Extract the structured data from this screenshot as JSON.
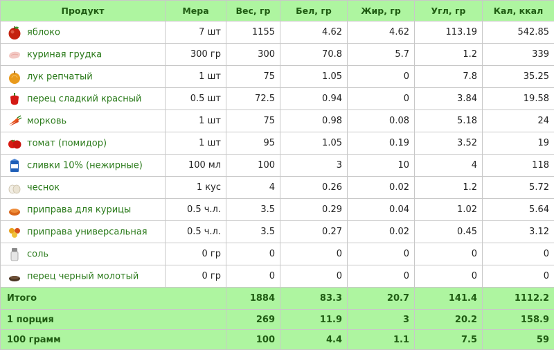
{
  "header": {
    "product": "Продукт",
    "mera": "Мера",
    "ves": "Вес, гр",
    "bel": "Бел, гр",
    "zhir": "Жир, гр",
    "ugl": "Угл, гр",
    "kal": "Кал, ккал"
  },
  "items": [
    {
      "name": "яблоко",
      "icon": "apple-icon",
      "mera": "7 шт",
      "ves": "1155",
      "bel": "4.62",
      "zhir": "4.62",
      "ugl": "113.19",
      "kal": "542.85"
    },
    {
      "name": "куриная грудка",
      "icon": "chicken-breast-icon",
      "mera": "300 гр",
      "ves": "300",
      "bel": "70.8",
      "zhir": "5.7",
      "ugl": "1.2",
      "kal": "339"
    },
    {
      "name": "лук репчатый",
      "icon": "onion-icon",
      "mera": "1 шт",
      "ves": "75",
      "bel": "1.05",
      "zhir": "0",
      "ugl": "7.8",
      "kal": "35.25"
    },
    {
      "name": "перец сладкий красный",
      "icon": "red-pepper-icon",
      "mera": "0.5 шт",
      "ves": "72.5",
      "bel": "0.94",
      "zhir": "0",
      "ugl": "3.84",
      "kal": "19.58"
    },
    {
      "name": "морковь",
      "icon": "carrot-icon",
      "mera": "1 шт",
      "ves": "75",
      "bel": "0.98",
      "zhir": "0.08",
      "ugl": "5.18",
      "kal": "24"
    },
    {
      "name": "томат (помидор)",
      "icon": "tomato-icon",
      "mera": "1 шт",
      "ves": "95",
      "bel": "1.05",
      "zhir": "0.19",
      "ugl": "3.52",
      "kal": "19"
    },
    {
      "name": "сливки 10% (нежирные)",
      "icon": "cream-carton-icon",
      "mera": "100 мл",
      "ves": "100",
      "bel": "3",
      "zhir": "10",
      "ugl": "4",
      "kal": "118"
    },
    {
      "name": "чеснок",
      "icon": "garlic-icon",
      "mera": "1 кус",
      "ves": "4",
      "bel": "0.26",
      "zhir": "0.02",
      "ugl": "1.2",
      "kal": "5.72"
    },
    {
      "name": "приправа для курицы",
      "icon": "seasoning-icon",
      "mera": "0.5 ч.л.",
      "ves": "3.5",
      "bel": "0.29",
      "zhir": "0.04",
      "ugl": "1.02",
      "kal": "5.64"
    },
    {
      "name": "приправа универсальная",
      "icon": "spices-icon",
      "mera": "0.5 ч.л.",
      "ves": "3.5",
      "bel": "0.27",
      "zhir": "0.02",
      "ugl": "0.45",
      "kal": "3.12"
    },
    {
      "name": "соль",
      "icon": "salt-shaker-icon",
      "mera": "0 гр",
      "ves": "0",
      "bel": "0",
      "zhir": "0",
      "ugl": "0",
      "kal": "0"
    },
    {
      "name": "перец черный молотый",
      "icon": "black-pepper-icon",
      "mera": "0 гр",
      "ves": "0",
      "bel": "0",
      "zhir": "0",
      "ugl": "0",
      "kal": "0"
    }
  ],
  "totals": [
    {
      "label": "Итого",
      "ves": "1884",
      "bel": "83.3",
      "zhir": "20.7",
      "ugl": "141.4",
      "kal": "1112.2"
    },
    {
      "label": "1 порция",
      "ves": "269",
      "bel": "11.9",
      "zhir": "3",
      "ugl": "20.2",
      "kal": "158.9"
    },
    {
      "label": "100 грамм",
      "ves": "100",
      "bel": "4.4",
      "zhir": "1.1",
      "ugl": "7.5",
      "kal": "59"
    }
  ],
  "colors": {
    "header_bg": "#aef5a0",
    "header_text": "#1f5b12",
    "link": "#2a7a1a"
  }
}
